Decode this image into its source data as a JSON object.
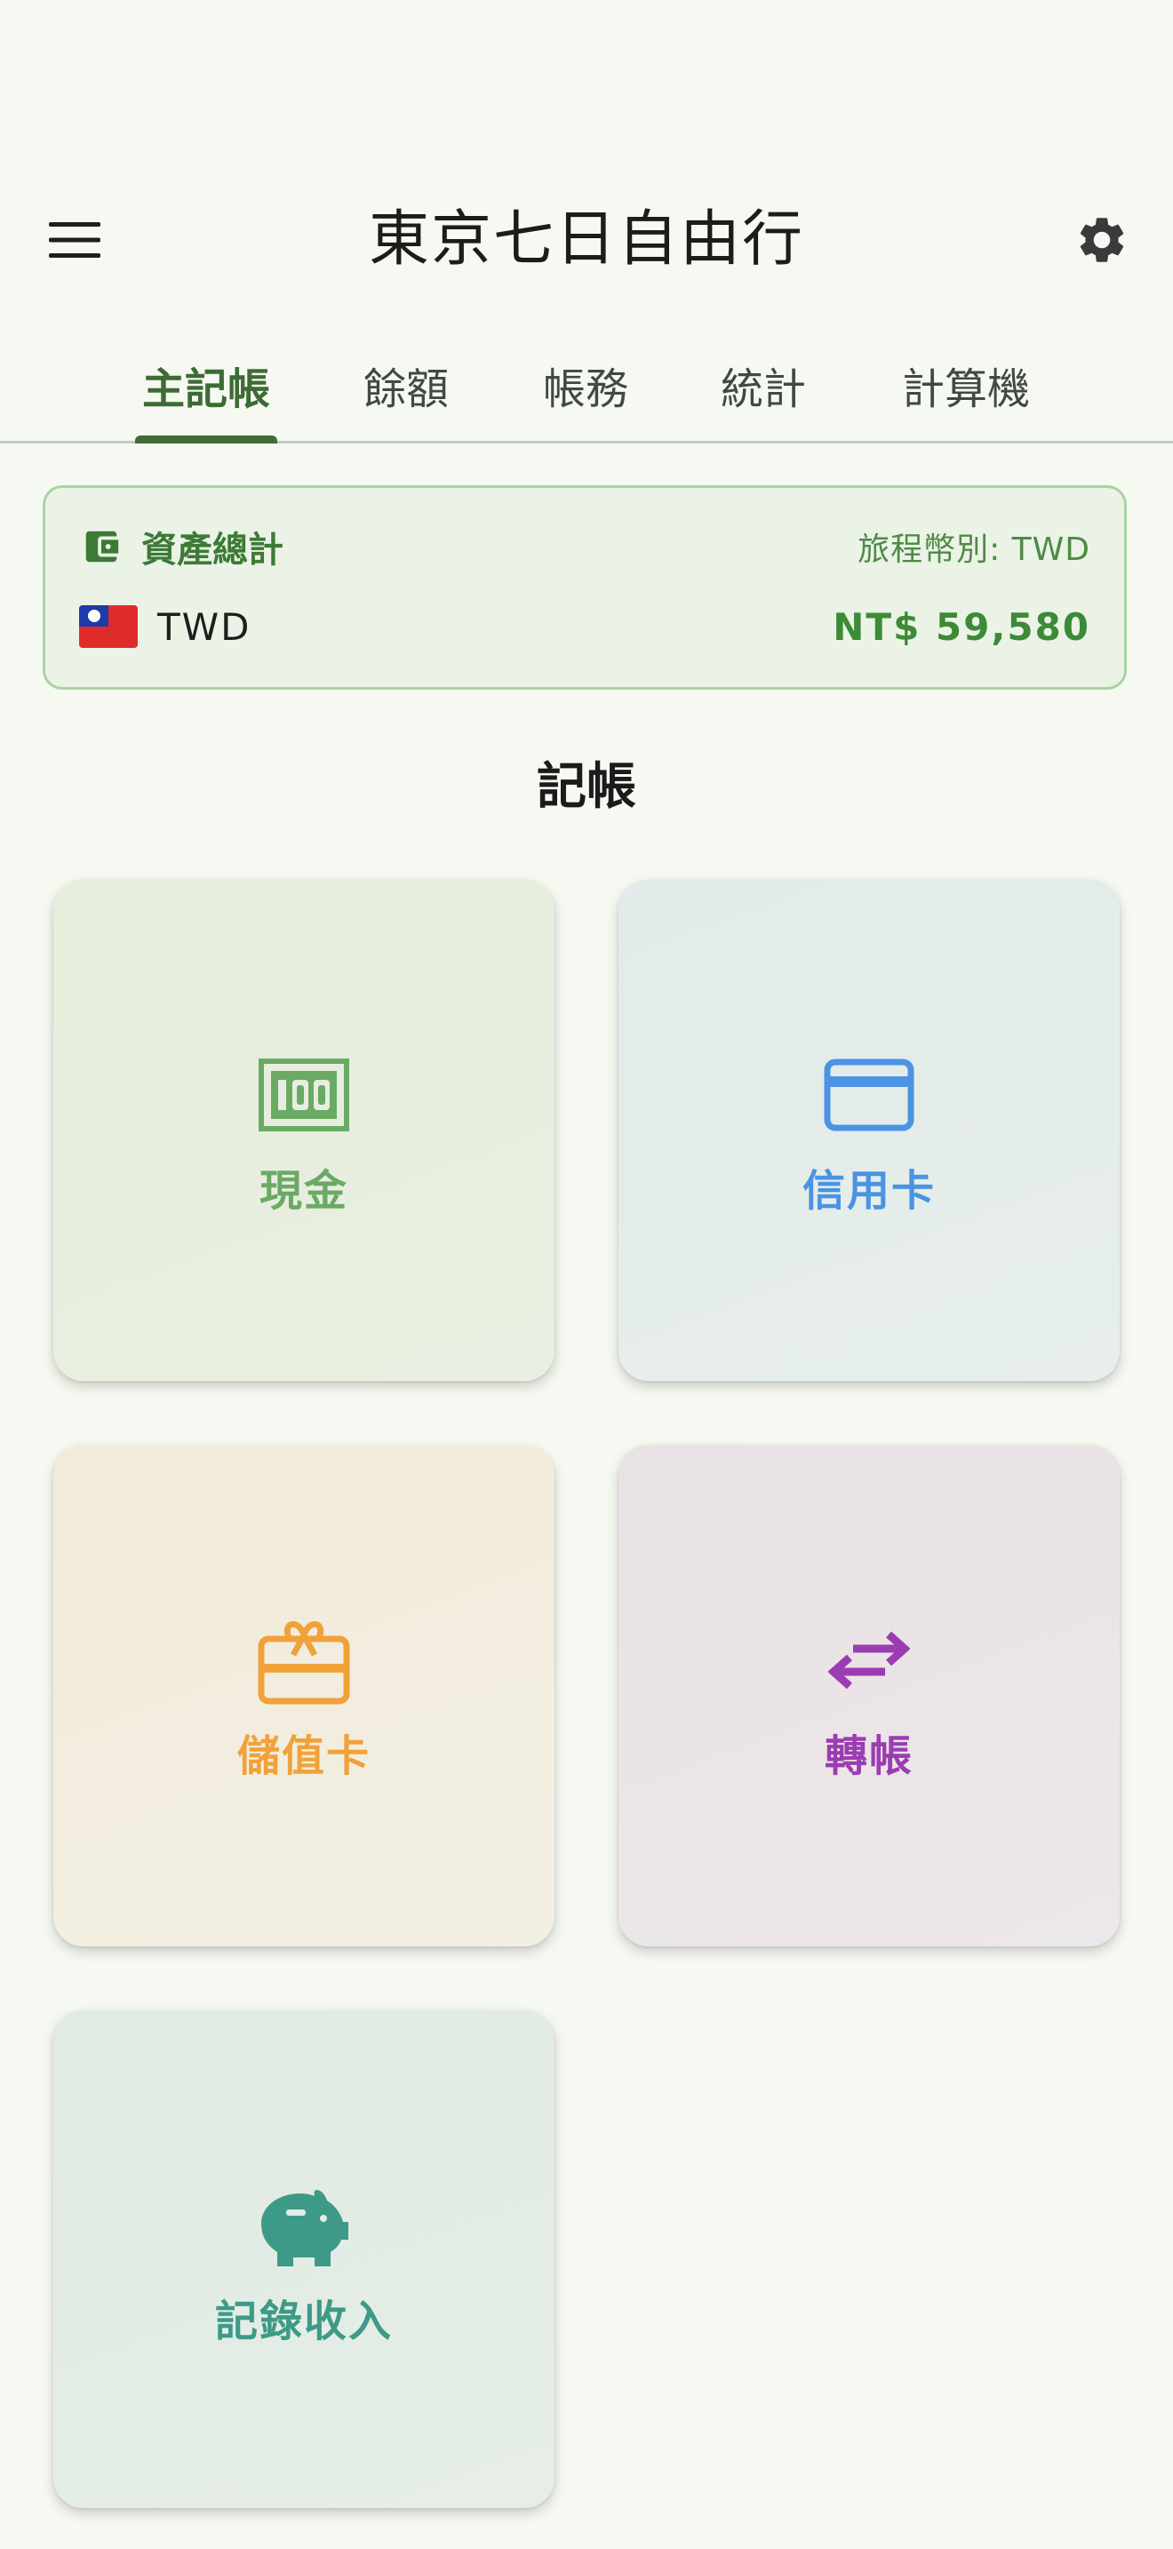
{
  "app": {
    "title": "東京七日自由行",
    "menu_icon": "menu-icon",
    "settings_icon": "gear-icon"
  },
  "tabs": [
    {
      "label": "主記帳",
      "active": true
    },
    {
      "label": "餘額",
      "active": false
    },
    {
      "label": "帳務",
      "active": false
    },
    {
      "label": "統計",
      "active": false
    },
    {
      "label": "計算機",
      "active": false
    }
  ],
  "asset_summary": {
    "title": "資產總計",
    "trip_currency": "旅程幣別: TWD",
    "currency_code": "TWD",
    "total": "NT$ 59,580",
    "icon": "wallet-icon",
    "flag": "taiwan-flag-icon"
  },
  "record_section": {
    "title": "記帳",
    "tiles": [
      {
        "label": "現金",
        "icon": "cash-icon",
        "color": "#6aaa64"
      },
      {
        "label": "信用卡",
        "icon": "credit-card-icon",
        "color": "#4b93e3"
      },
      {
        "label": "儲值卡",
        "icon": "gift-card-icon",
        "color": "#f0a23a"
      },
      {
        "label": "轉帳",
        "icon": "transfer-icon",
        "color": "#9b3db1"
      },
      {
        "label": "記錄收入",
        "icon": "piggy-bank-icon",
        "color": "#3e9a88"
      }
    ]
  },
  "colors": {
    "background": "#f6f9f1",
    "accent": "#3f6b37",
    "asset_card_bg": "#ebf3e6",
    "asset_card_border": "#a9d3a3"
  }
}
